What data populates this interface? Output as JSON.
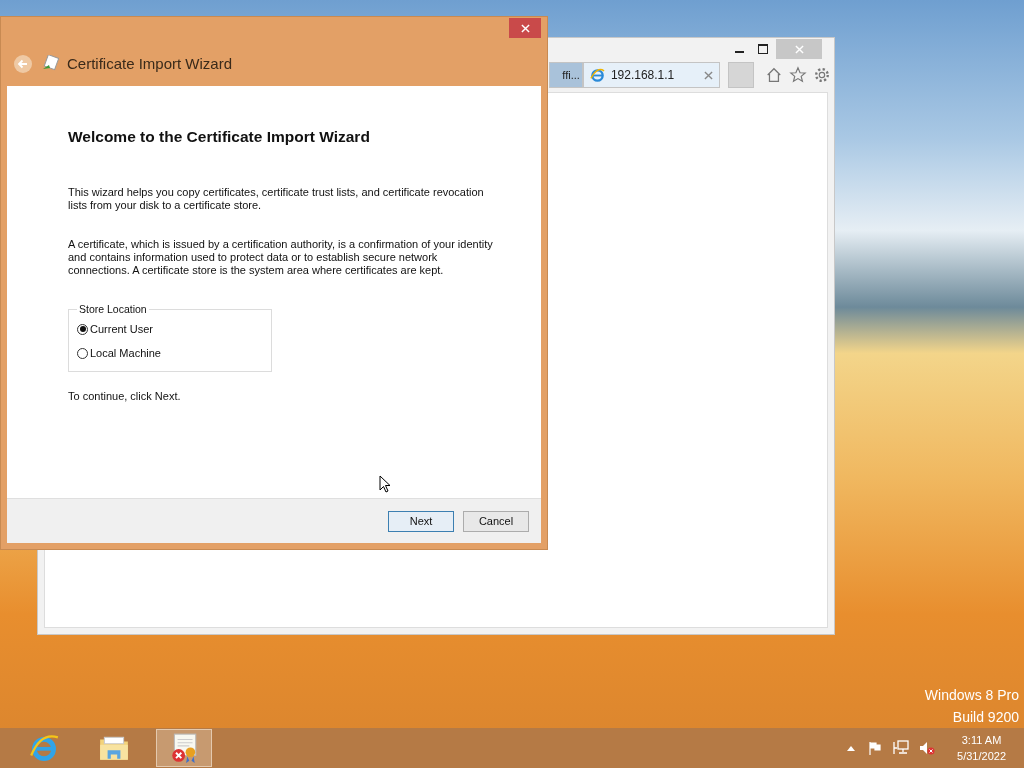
{
  "browser": {
    "tabs": [
      {
        "label": "ffi...",
        "selected": false
      },
      {
        "label": "192.168.1.1",
        "selected": true
      }
    ]
  },
  "wizard": {
    "title": "Certificate Import Wizard",
    "heading": "Welcome to the Certificate Import Wizard",
    "paragraphs": [
      "This wizard helps you copy certificates, certificate trust lists, and certificate revocation lists from your disk to a certificate store.",
      "A certificate, which is issued by a certification authority, is a confirmation of your identity and contains information used to protect data or to establish secure network connections. A certificate store is the system area where certificates are kept."
    ],
    "store_location": {
      "legend": "Store Location",
      "options": [
        {
          "label": "Current User",
          "selected": true
        },
        {
          "label": "Local Machine",
          "selected": false
        }
      ]
    },
    "instruction": "To continue, click Next.",
    "buttons": [
      {
        "label": "Next",
        "kind": "default"
      },
      {
        "label": "Cancel",
        "kind": "normal"
      }
    ]
  },
  "watermark": {
    "edition": "Windows 8 Pro",
    "build": "Build 9200"
  },
  "taskbar": {
    "apps": [
      {
        "kind": "browser",
        "selected": false
      },
      {
        "kind": "folder",
        "selected": false
      },
      {
        "kind": "certificate",
        "selected": true
      }
    ],
    "clock": {
      "time": "3:11 AM",
      "date": "5/31/2022"
    }
  }
}
